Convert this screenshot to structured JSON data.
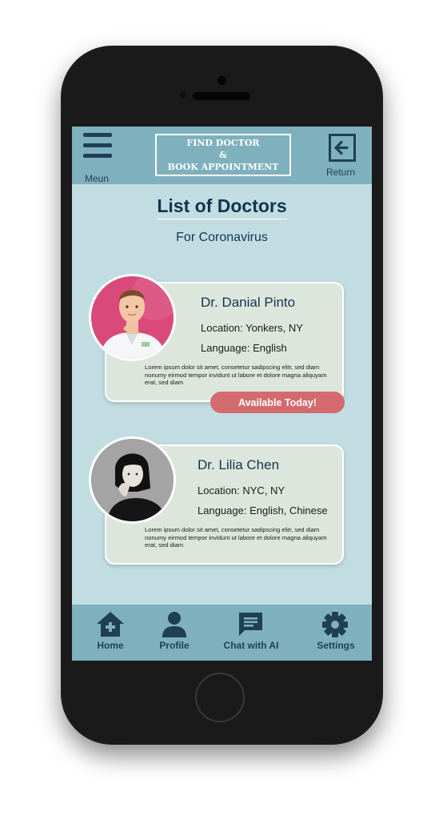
{
  "header": {
    "menu_label": "Meun",
    "title_line1": "FIND DOCTOR",
    "title_line2": "&",
    "title_line3": "BOOK APPOINTMENT",
    "return_label": "Return"
  },
  "page": {
    "title": "List of Doctors",
    "subtitle": "For Coronavirus"
  },
  "doctors": [
    {
      "name": "Dr. Danial Pinto",
      "location": "Location: Yonkers, NY",
      "language": "Language: English",
      "description": "Lorem ipsum dolor sit amet, consetetur sadipscing elitr, sed diam nonumy eirmod tempor invidunt ut labore et dolore magna aliquyam erat, sed diam",
      "badge": "Available Today!"
    },
    {
      "name": "Dr. Lilia Chen",
      "location": "Location: NYC, NY",
      "language": "Language: English, Chinese",
      "description": "Lorem ipsum dolor sit amet, consetetur sadipscing elitr, sed diam nonumy eirmod tempor invidunt ut labore et dolore magna aliquyam erat, sed diam"
    }
  ],
  "nav": {
    "items": [
      {
        "label": "Home",
        "icon": "home-icon"
      },
      {
        "label": "Profile",
        "icon": "person-icon"
      },
      {
        "label": "Chat with AI",
        "icon": "chat-icon"
      },
      {
        "label": "Settings",
        "icon": "gear-icon"
      }
    ]
  },
  "colors": {
    "screen_bg": "#c2dde2",
    "bar_bg": "#7fb0bd",
    "card_bg": "#dde6dc",
    "text_dark": "#12344f",
    "badge_bg": "#d36a6e"
  }
}
